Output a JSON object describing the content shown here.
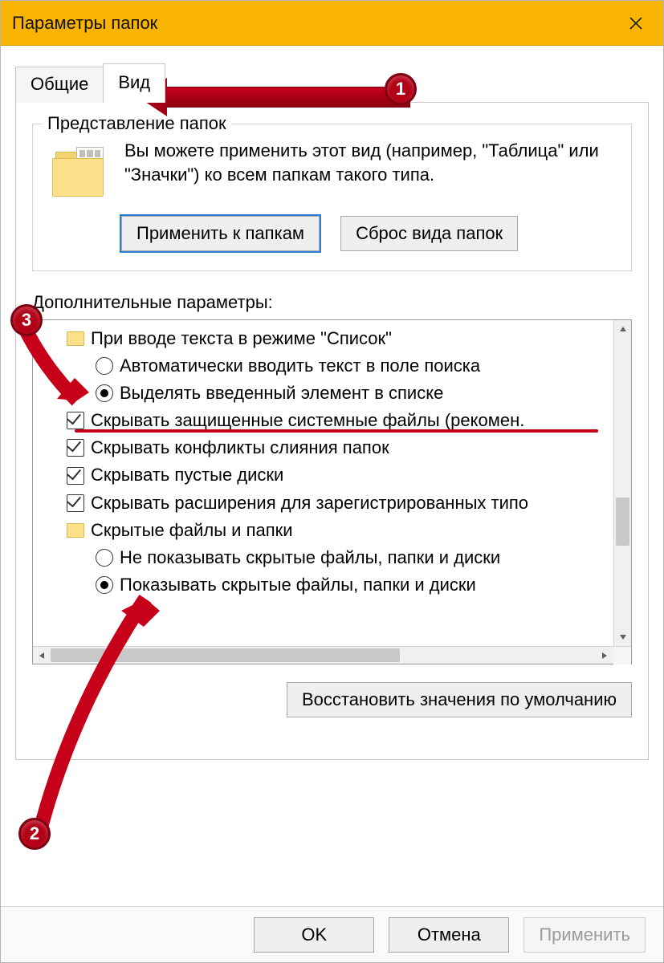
{
  "window": {
    "title": "Параметры папок"
  },
  "tabs": {
    "general": "Общие",
    "view": "Вид"
  },
  "group": {
    "legend": "Представление папок",
    "text": "Вы можете применить этот вид (например, \"Таблица\" или \"Значки\") ко всем папкам такого типа.",
    "apply": "Применить к папкам",
    "reset": "Сброс вида папок"
  },
  "advanced": {
    "label": "Дополнительные параметры:",
    "items": [
      {
        "type": "folder",
        "indent": 1,
        "label": "При вводе текста в режиме \"Список\""
      },
      {
        "type": "radio",
        "indent": 2,
        "selected": false,
        "label": "Автоматически вводить текст в поле поиска"
      },
      {
        "type": "radio",
        "indent": 2,
        "selected": true,
        "label": "Выделять введенный элемент в списке"
      },
      {
        "type": "check",
        "indent": 1,
        "selected": true,
        "label": "Скрывать защищенные системные файлы (рекомен."
      },
      {
        "type": "check",
        "indent": 1,
        "selected": true,
        "label": "Скрывать конфликты слияния папок"
      },
      {
        "type": "check",
        "indent": 1,
        "selected": true,
        "label": "Скрывать пустые диски"
      },
      {
        "type": "check",
        "indent": 1,
        "selected": true,
        "label": "Скрывать расширения для зарегистрированных типо"
      },
      {
        "type": "folder",
        "indent": 1,
        "label": "Скрытые файлы и папки"
      },
      {
        "type": "radio",
        "indent": 2,
        "selected": false,
        "label": "Не показывать скрытые файлы, папки и диски"
      },
      {
        "type": "radio",
        "indent": 2,
        "selected": true,
        "label": "Показывать скрытые файлы, папки и диски"
      }
    ],
    "restore": "Восстановить значения по умолчанию"
  },
  "buttons": {
    "ok": "OK",
    "cancel": "Отмена",
    "apply": "Применить"
  },
  "annotations": {
    "badge1": "1",
    "badge2": "2",
    "badge3": "3"
  }
}
